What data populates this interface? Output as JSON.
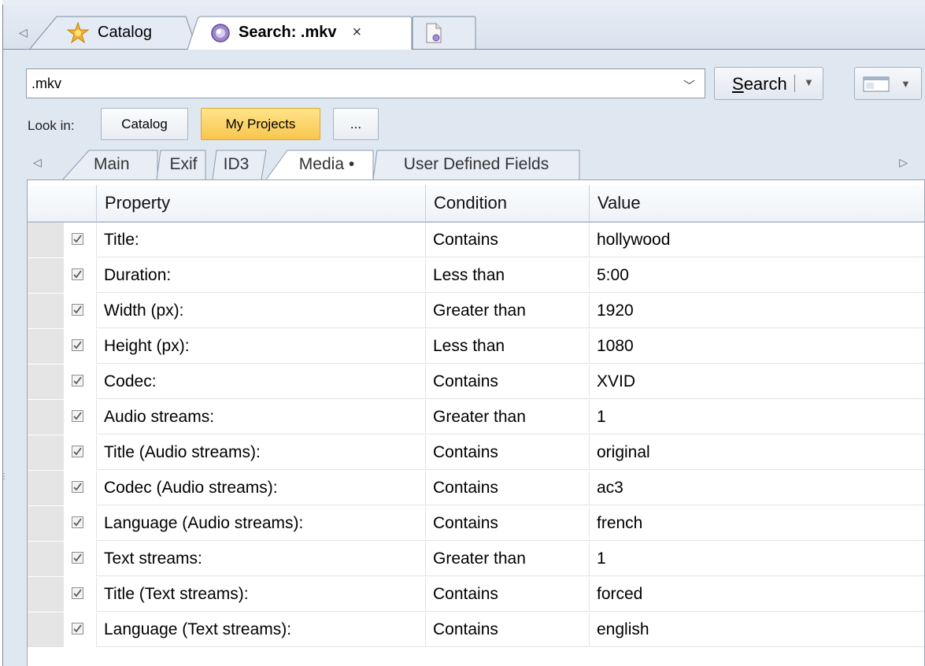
{
  "document_tabs": [
    {
      "label": "Catalog",
      "icon": "catalog-star-icon"
    },
    {
      "label": "Search: .mkv",
      "icon": "search-disc-icon",
      "close": "×",
      "active": true
    },
    {
      "label": "",
      "icon": "new-document-icon"
    }
  ],
  "search": {
    "query": ".mkv",
    "button_label_accesskey": "S",
    "button_label_rest": "earch"
  },
  "look_in": {
    "label": "Look in:",
    "scopes": [
      "Catalog",
      "My Projects",
      "..."
    ],
    "selected": "My Projects"
  },
  "property_tabs": [
    "Main",
    "Exif",
    "ID3",
    "Media •",
    "User Defined Fields"
  ],
  "active_property_tab": "Media •",
  "grid": {
    "columns": [
      "Property",
      "Condition",
      "Value"
    ],
    "rows": [
      {
        "checked": true,
        "property": "Title:",
        "condition": "Contains",
        "value": "hollywood"
      },
      {
        "checked": true,
        "property": "Duration:",
        "condition": "Less than",
        "value": "5:00"
      },
      {
        "checked": true,
        "property": "Width (px):",
        "condition": "Greater than",
        "value": "1920"
      },
      {
        "checked": true,
        "property": "Height (px):",
        "condition": "Less than",
        "value": "1080"
      },
      {
        "checked": true,
        "property": "Codec:",
        "condition": "Contains",
        "value": "XVID"
      },
      {
        "checked": true,
        "property": "Audio streams:",
        "condition": "Greater than",
        "value": "1"
      },
      {
        "checked": true,
        "property": "Title (Audio streams):",
        "condition": "Contains",
        "value": "original"
      },
      {
        "checked": true,
        "property": "Codec (Audio streams):",
        "condition": "Contains",
        "value": "ac3"
      },
      {
        "checked": true,
        "property": "Language (Audio streams):",
        "condition": "Contains",
        "value": "french"
      },
      {
        "checked": true,
        "property": "Text streams:",
        "condition": "Greater than",
        "value": "1"
      },
      {
        "checked": true,
        "property": "Title (Text streams):",
        "condition": "Contains",
        "value": "forced"
      },
      {
        "checked": true,
        "property": "Language (Text streams):",
        "condition": "Contains",
        "value": "english"
      }
    ]
  },
  "colors": {
    "frame": "#dfe7f1",
    "selected_scope": "#f8c64e",
    "gutter": "#e5e5e5"
  }
}
